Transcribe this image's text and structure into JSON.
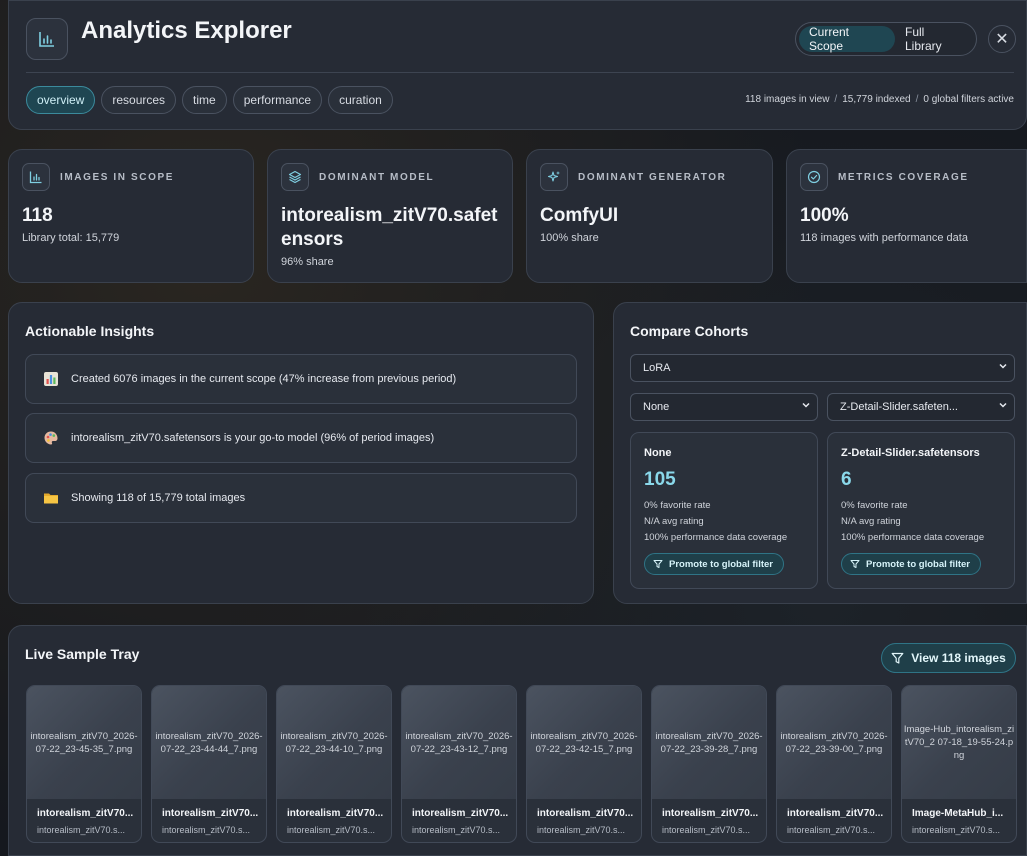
{
  "app": {
    "title": "Analytics Explorer"
  },
  "scope": {
    "current_label": "Current Scope",
    "full_label": "Full Library",
    "active": "current"
  },
  "tabs": [
    {
      "label": "overview",
      "active": true
    },
    {
      "label": "resources",
      "active": false
    },
    {
      "label": "time",
      "active": false
    },
    {
      "label": "performance",
      "active": false
    },
    {
      "label": "curation",
      "active": false
    }
  ],
  "summary": {
    "in_view": "118 images in view",
    "indexed": "15,779 indexed",
    "filters": "0 global filters active",
    "separator": "/"
  },
  "stats": [
    {
      "icon": "bar-chart-icon",
      "label": "IMAGES IN SCOPE",
      "value": "118",
      "sub": "Library total: 15,779"
    },
    {
      "icon": "layers-icon",
      "label": "DOMINANT MODEL",
      "value": "intorealism_zitV70.safetensors",
      "sub": "96% share"
    },
    {
      "icon": "sparkles-icon",
      "label": "DOMINANT GENERATOR",
      "value": "ComfyUI",
      "sub": "100% share"
    },
    {
      "icon": "check-circle-icon",
      "label": "METRICS COVERAGE",
      "value": "100%",
      "sub": "118 images with performance data"
    }
  ],
  "insights": {
    "title": "Actionable Insights",
    "items": [
      {
        "icon": "chart-emoji-icon",
        "text": "Created 6076 images in the current scope (47% increase from previous period)"
      },
      {
        "icon": "palette-emoji-icon",
        "text": "intorealism_zitV70.safetensors is your go-to model (96% of period images)"
      },
      {
        "icon": "folder-emoji-icon",
        "text": "Showing 118 of 15,779 total images"
      }
    ]
  },
  "compare": {
    "title": "Compare Cohorts",
    "dimension": "LoRA",
    "left_select": "None",
    "right_select": "Z-Detail-Slider.safeten...",
    "promote_label": "Promote to global filter",
    "cohorts": [
      {
        "name": "None",
        "count": "105",
        "favorite": "0% favorite rate",
        "rating": "N/A avg rating",
        "coverage": "100% performance data coverage"
      },
      {
        "name": "Z-Detail-Slider.safetensors",
        "count": "6",
        "favorite": "0% favorite rate",
        "rating": "N/A avg rating",
        "coverage": "100% performance data coverage"
      }
    ]
  },
  "tray": {
    "title": "Live Sample Tray",
    "view_button": "View 118 images",
    "items": [
      {
        "filename": "intorealism_zitV70_2026-07-22_23-45-35_7.png",
        "title": "intorealism_zitV70...",
        "sub": "intorealism_zitV70.s..."
      },
      {
        "filename": "intorealism_zitV70_2026-07-22_23-44-44_7.png",
        "title": "intorealism_zitV70...",
        "sub": "intorealism_zitV70.s..."
      },
      {
        "filename": "intorealism_zitV70_2026-07-22_23-44-10_7.png",
        "title": "intorealism_zitV70...",
        "sub": "intorealism_zitV70.s..."
      },
      {
        "filename": "intorealism_zitV70_2026-07-22_23-43-12_7.png",
        "title": "intorealism_zitV70...",
        "sub": "intorealism_zitV70.s..."
      },
      {
        "filename": "intorealism_zitV70_2026-07-22_23-42-15_7.png",
        "title": "intorealism_zitV70...",
        "sub": "intorealism_zitV70.s..."
      },
      {
        "filename": "intorealism_zitV70_2026-07-22_23-39-28_7.png",
        "title": "intorealism_zitV70...",
        "sub": "intorealism_zitV70.s..."
      },
      {
        "filename": "intorealism_zitV70_2026-07-22_23-39-00_7.png",
        "title": "intorealism_zitV70...",
        "sub": "intorealism_zitV70.s..."
      },
      {
        "filename": "Image-Hub_intorealism_zitV70_2 07-18_19-55-24.png",
        "title": "Image-MetaHub_i...",
        "sub": "intorealism_zitV70.s..."
      }
    ]
  },
  "colors": {
    "accent": "#8ad8ea",
    "active_bg": "#1f4652",
    "panel": "#262b35"
  }
}
